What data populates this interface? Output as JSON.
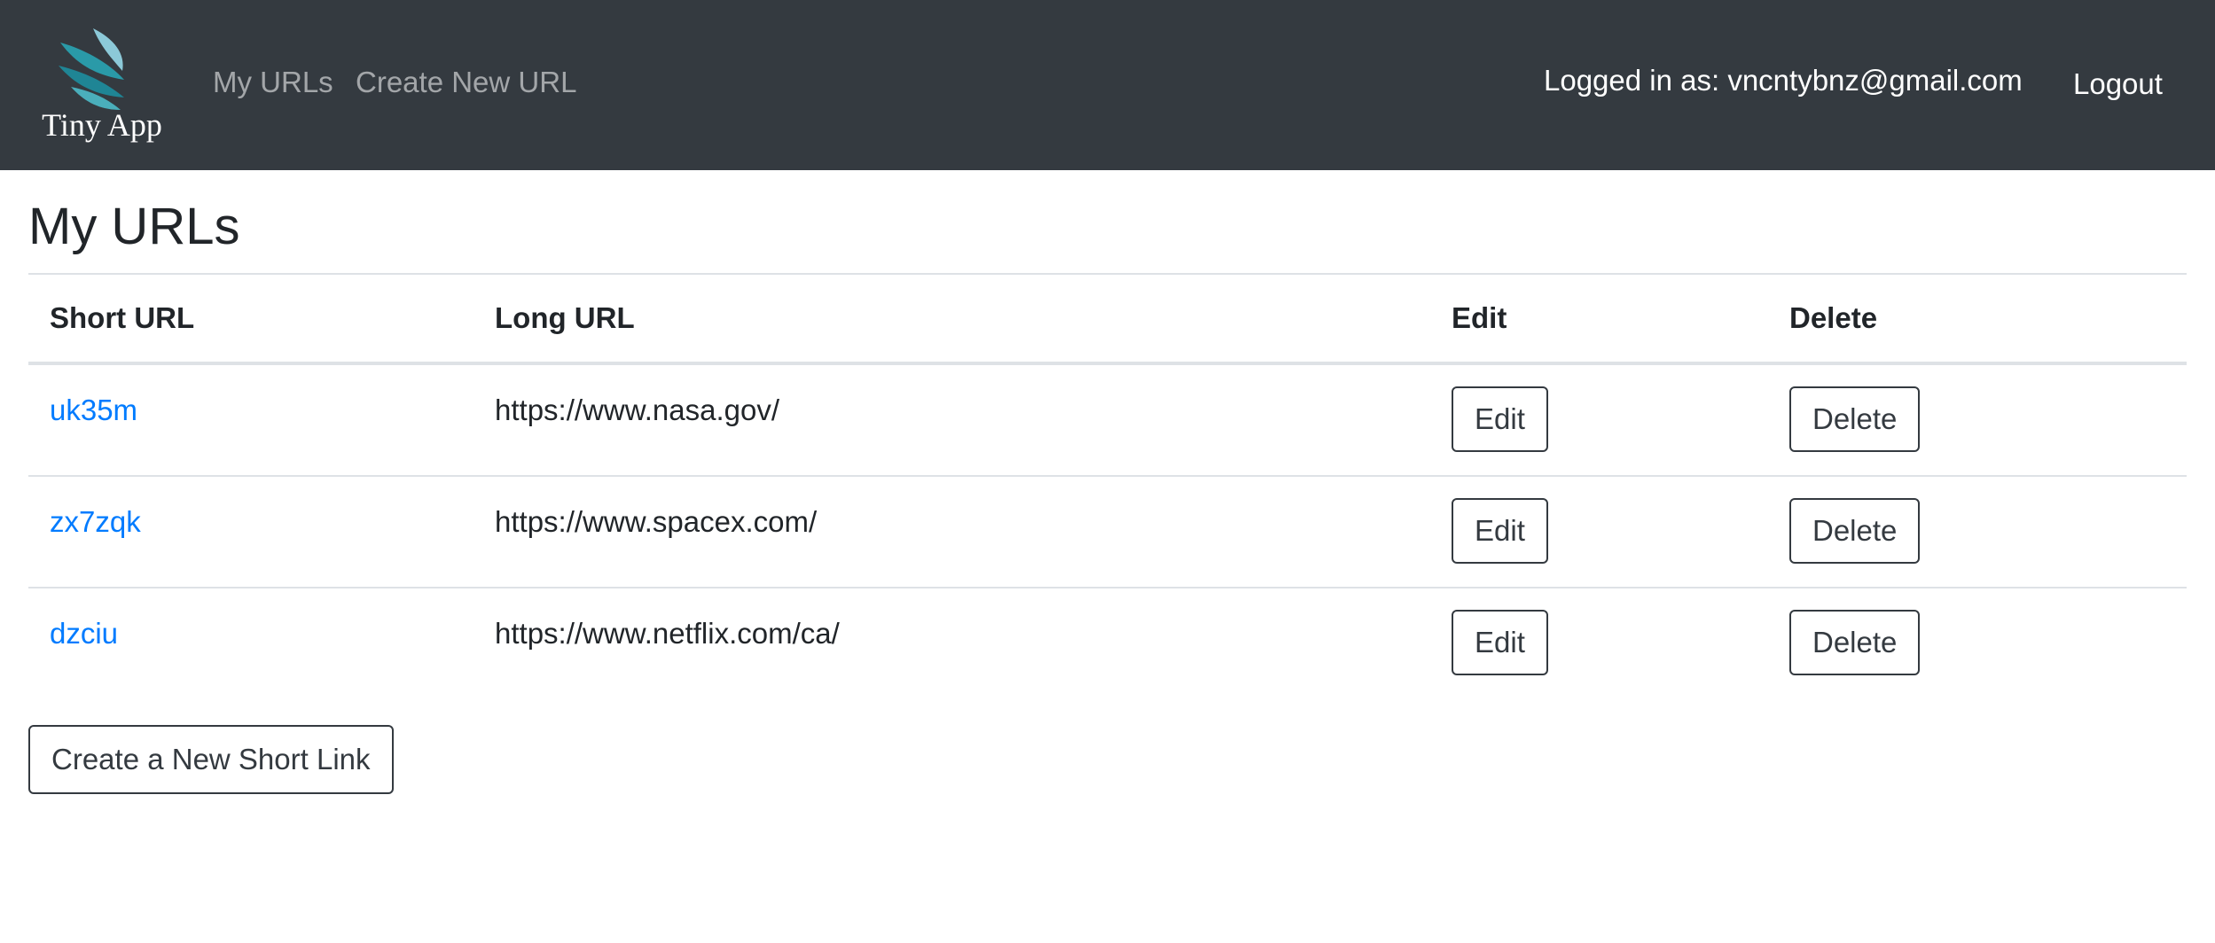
{
  "nav": {
    "brand_text": "Tiny App",
    "brand_icon": "feather-logo-icon",
    "my_urls": "My URLs",
    "create_new_url": "Create New URL",
    "logged_in_text": "Logged in as: vncntybnz@gmail.com",
    "logout": "Logout"
  },
  "main": {
    "title": "My URLs",
    "columns": {
      "short": "Short URL",
      "long": "Long URL",
      "edit": "Edit",
      "delete": "Delete"
    },
    "rows": [
      {
        "short": "uk35m",
        "long": "https://www.nasa.gov/",
        "edit": "Edit",
        "delete": "Delete"
      },
      {
        "short": "zx7zqk",
        "long": "https://www.spacex.com/",
        "edit": "Edit",
        "delete": "Delete"
      },
      {
        "short": "dzciu",
        "long": "https://www.netflix.com/ca/",
        "edit": "Edit",
        "delete": "Delete"
      }
    ],
    "create_button": "Create a New Short Link"
  },
  "colors": {
    "navbar_bg": "#343a40",
    "link": "#007bff",
    "text": "#212529",
    "logo_teal": "#2a9aa8",
    "logo_light": "#7fc4d4"
  }
}
